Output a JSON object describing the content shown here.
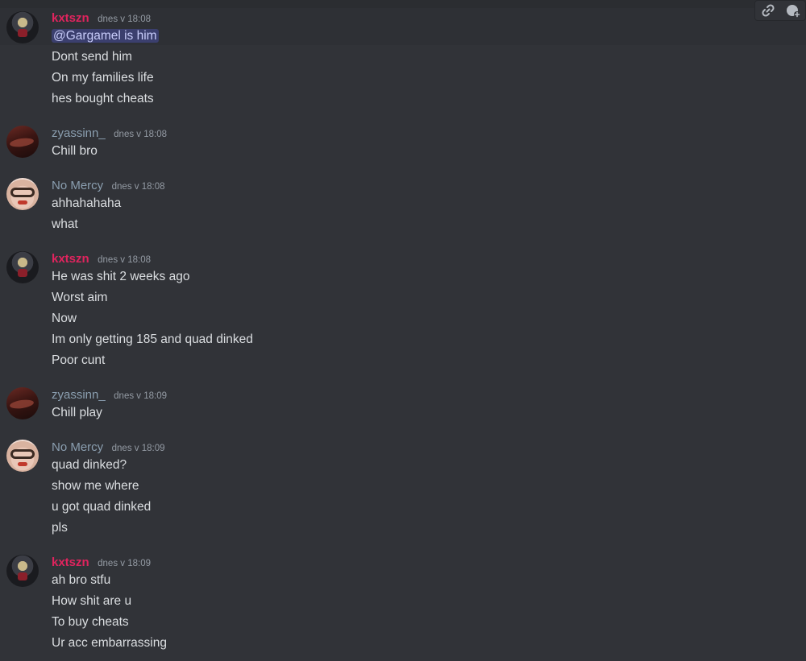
{
  "toolbar": {
    "icons": [
      "link-icon",
      "add-reaction-icon"
    ]
  },
  "messages": [
    {
      "user": "kxtszn",
      "time": "dnes v 18:08",
      "lines": [
        "@Gargamel is him",
        "Dont send him",
        "On my families life",
        "hes bought cheats"
      ]
    },
    {
      "user": "zyassinn_",
      "time": "dnes v 18:08",
      "lines": [
        "Chill bro"
      ]
    },
    {
      "user": "No Mercy",
      "time": "dnes v 18:08",
      "lines": [
        "ahhahahaha",
        "what"
      ]
    },
    {
      "user": "kxtszn",
      "time": "dnes v 18:08",
      "lines": [
        "He was shit 2 weeks ago",
        "Worst aim",
        "Now",
        "Im only getting 185 and quad dinked",
        "Poor cunt"
      ]
    },
    {
      "user": "zyassinn_",
      "time": "dnes v 18:09",
      "lines": [
        "Chill play"
      ]
    },
    {
      "user": "No Mercy",
      "time": "dnes v 18:09",
      "lines": [
        "quad dinked?",
        "show me where",
        "u got quad dinked",
        "pls"
      ]
    },
    {
      "user": "kxtszn",
      "time": "dnes v 18:09",
      "lines": [
        "ah bro stfu",
        "How shit are u",
        "To buy cheats",
        "Ur acc embarrassing"
      ]
    }
  ]
}
